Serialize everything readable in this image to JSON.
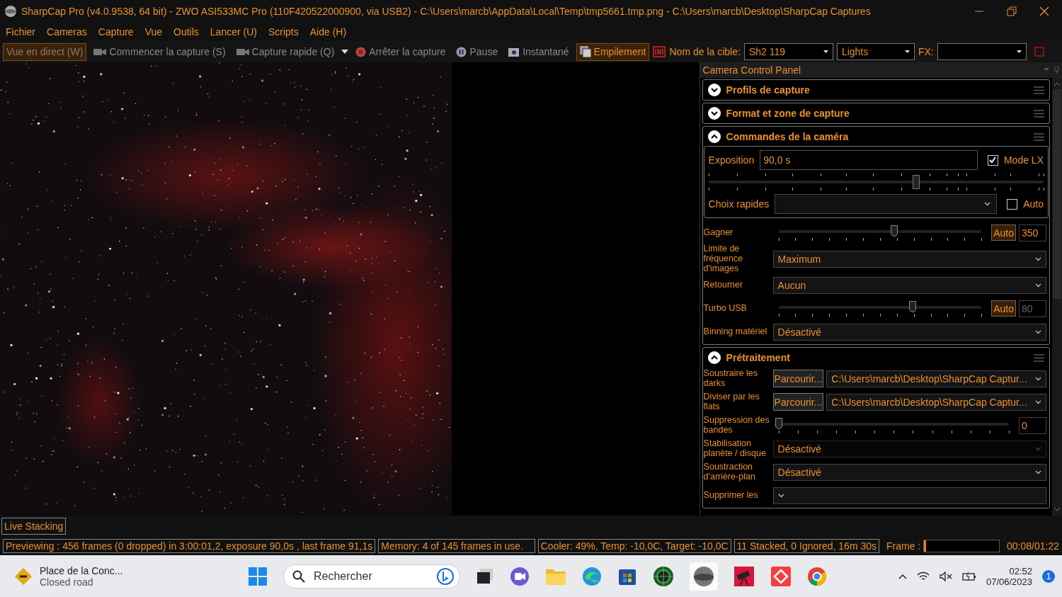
{
  "window": {
    "title": "SharpCap Pro (v4.0.9538, 64 bit) - ZWO ASI533MC Pro (110F420522000900, via USB2) - C:\\Users\\marcb\\AppData\\Local\\Temp\\tmp5661.tmp.png - C:\\Users\\marcb\\Desktop\\SharpCap Captures"
  },
  "menu": [
    "Fichier",
    "Cameras",
    "Capture",
    "Vue",
    "Outils",
    "Lancer (U)",
    "Scripts",
    "Aide (H)"
  ],
  "toolbar": {
    "buttons": [
      {
        "kind": "toggle",
        "label": "Vue en direct (W)",
        "active": true,
        "disabled": true
      },
      {
        "kind": "camera",
        "label": "Commencer la capture (S)",
        "active": false,
        "disabled": true
      },
      {
        "kind": "camera",
        "label": "Capture rapide (Q)",
        "active": false,
        "disabled": true
      },
      {
        "kind": "stop",
        "label": "Arrêter la capture",
        "active": false,
        "disabled": true
      },
      {
        "kind": "pause",
        "label": "Pause",
        "active": false,
        "disabled": true
      },
      {
        "kind": "snapshot",
        "label": "Instantané",
        "active": false,
        "disabled": true
      },
      {
        "kind": "stack",
        "label": "Empilement",
        "active": true,
        "disabled": false
      }
    ],
    "target_label": "Nom de la cible:",
    "target_value": "Sh2 119",
    "frame_type": "Lights",
    "fx_label": "FX:"
  },
  "panel": {
    "title": "Camera Control Panel",
    "sections": [
      {
        "title": "Profils de capture",
        "expanded": false
      },
      {
        "title": "Format et zone de capture",
        "expanded": false
      },
      {
        "title": "Commandes de la caméra",
        "expanded": true,
        "rows": [
          {
            "kind": "exposure",
            "label": "Exposition",
            "value": "90,0 s",
            "lx_label": "Mode LX",
            "lx_checked": true,
            "level": 0.62,
            "quick_label": "Choix rapides",
            "auto_label": "Auto",
            "auto_checked": false
          },
          {
            "kind": "slider",
            "label": "Gagner",
            "level": 0.57,
            "auto_label": "Auto",
            "auto_active": true,
            "value": "350",
            "value_disabled": false
          },
          {
            "kind": "select",
            "label": "Limite de fréquence d'images",
            "value": "Maximum",
            "disabled": false
          },
          {
            "kind": "select",
            "label": "Retourner",
            "value": "Aucun",
            "disabled": false
          },
          {
            "kind": "slider",
            "label": "Turbo USB",
            "level": 0.66,
            "auto_label": "Auto",
            "auto_active": true,
            "value": "80",
            "value_disabled": true
          },
          {
            "kind": "select",
            "label": "Binning matériel",
            "value": "Désactivé",
            "disabled": false
          }
        ]
      },
      {
        "title": "Prétraitement",
        "expanded": true,
        "rows": [
          {
            "kind": "file",
            "label": "Soustraire les darks",
            "button": "Parcourir...",
            "path": "C:\\Users\\marcb\\Desktop\\SharpCap Captur..."
          },
          {
            "kind": "file",
            "label": "Diviser par les flats",
            "button": "Parcourir...",
            "path": "C:\\Users\\marcb\\Desktop\\SharpCap Captur..."
          },
          {
            "kind": "slider",
            "label": "Suppression des bandes",
            "level": 0,
            "value": "0",
            "value_disabled": false
          },
          {
            "kind": "select",
            "label": "Stabilisation planète / disque",
            "value": "Désactivé",
            "disabled": true
          },
          {
            "kind": "select",
            "label": "Soustraction d'arrière-plan",
            "value": "Désactivé",
            "disabled": false
          },
          {
            "kind": "select",
            "label": "Supprimer les",
            "disabled": false
          }
        ]
      }
    ]
  },
  "bottom_tab": "Live Stacking",
  "status_bar": {
    "texts": [
      "Previewing : 456 frames (0 dropped) in 3:00:01,2, exposure 90,0s , last frame 91,1s",
      "Memory: 4 of 145 frames in use.",
      "Cooler: 49%, Temp: -10,0C, Target: -10,0C",
      "11 Stacked, 0 Ignored, 16m 30s"
    ],
    "frame": {
      "label": "Frame :",
      "level": 0.03,
      "time": "00:08/01:22"
    }
  },
  "taskbar": {
    "weather_title": "Place de la Conc...",
    "weather_subtitle": "Closed road",
    "search_placeholder": "Rechercher",
    "time": "02:52",
    "date": "07/06/2023",
    "notification_count": "1"
  }
}
